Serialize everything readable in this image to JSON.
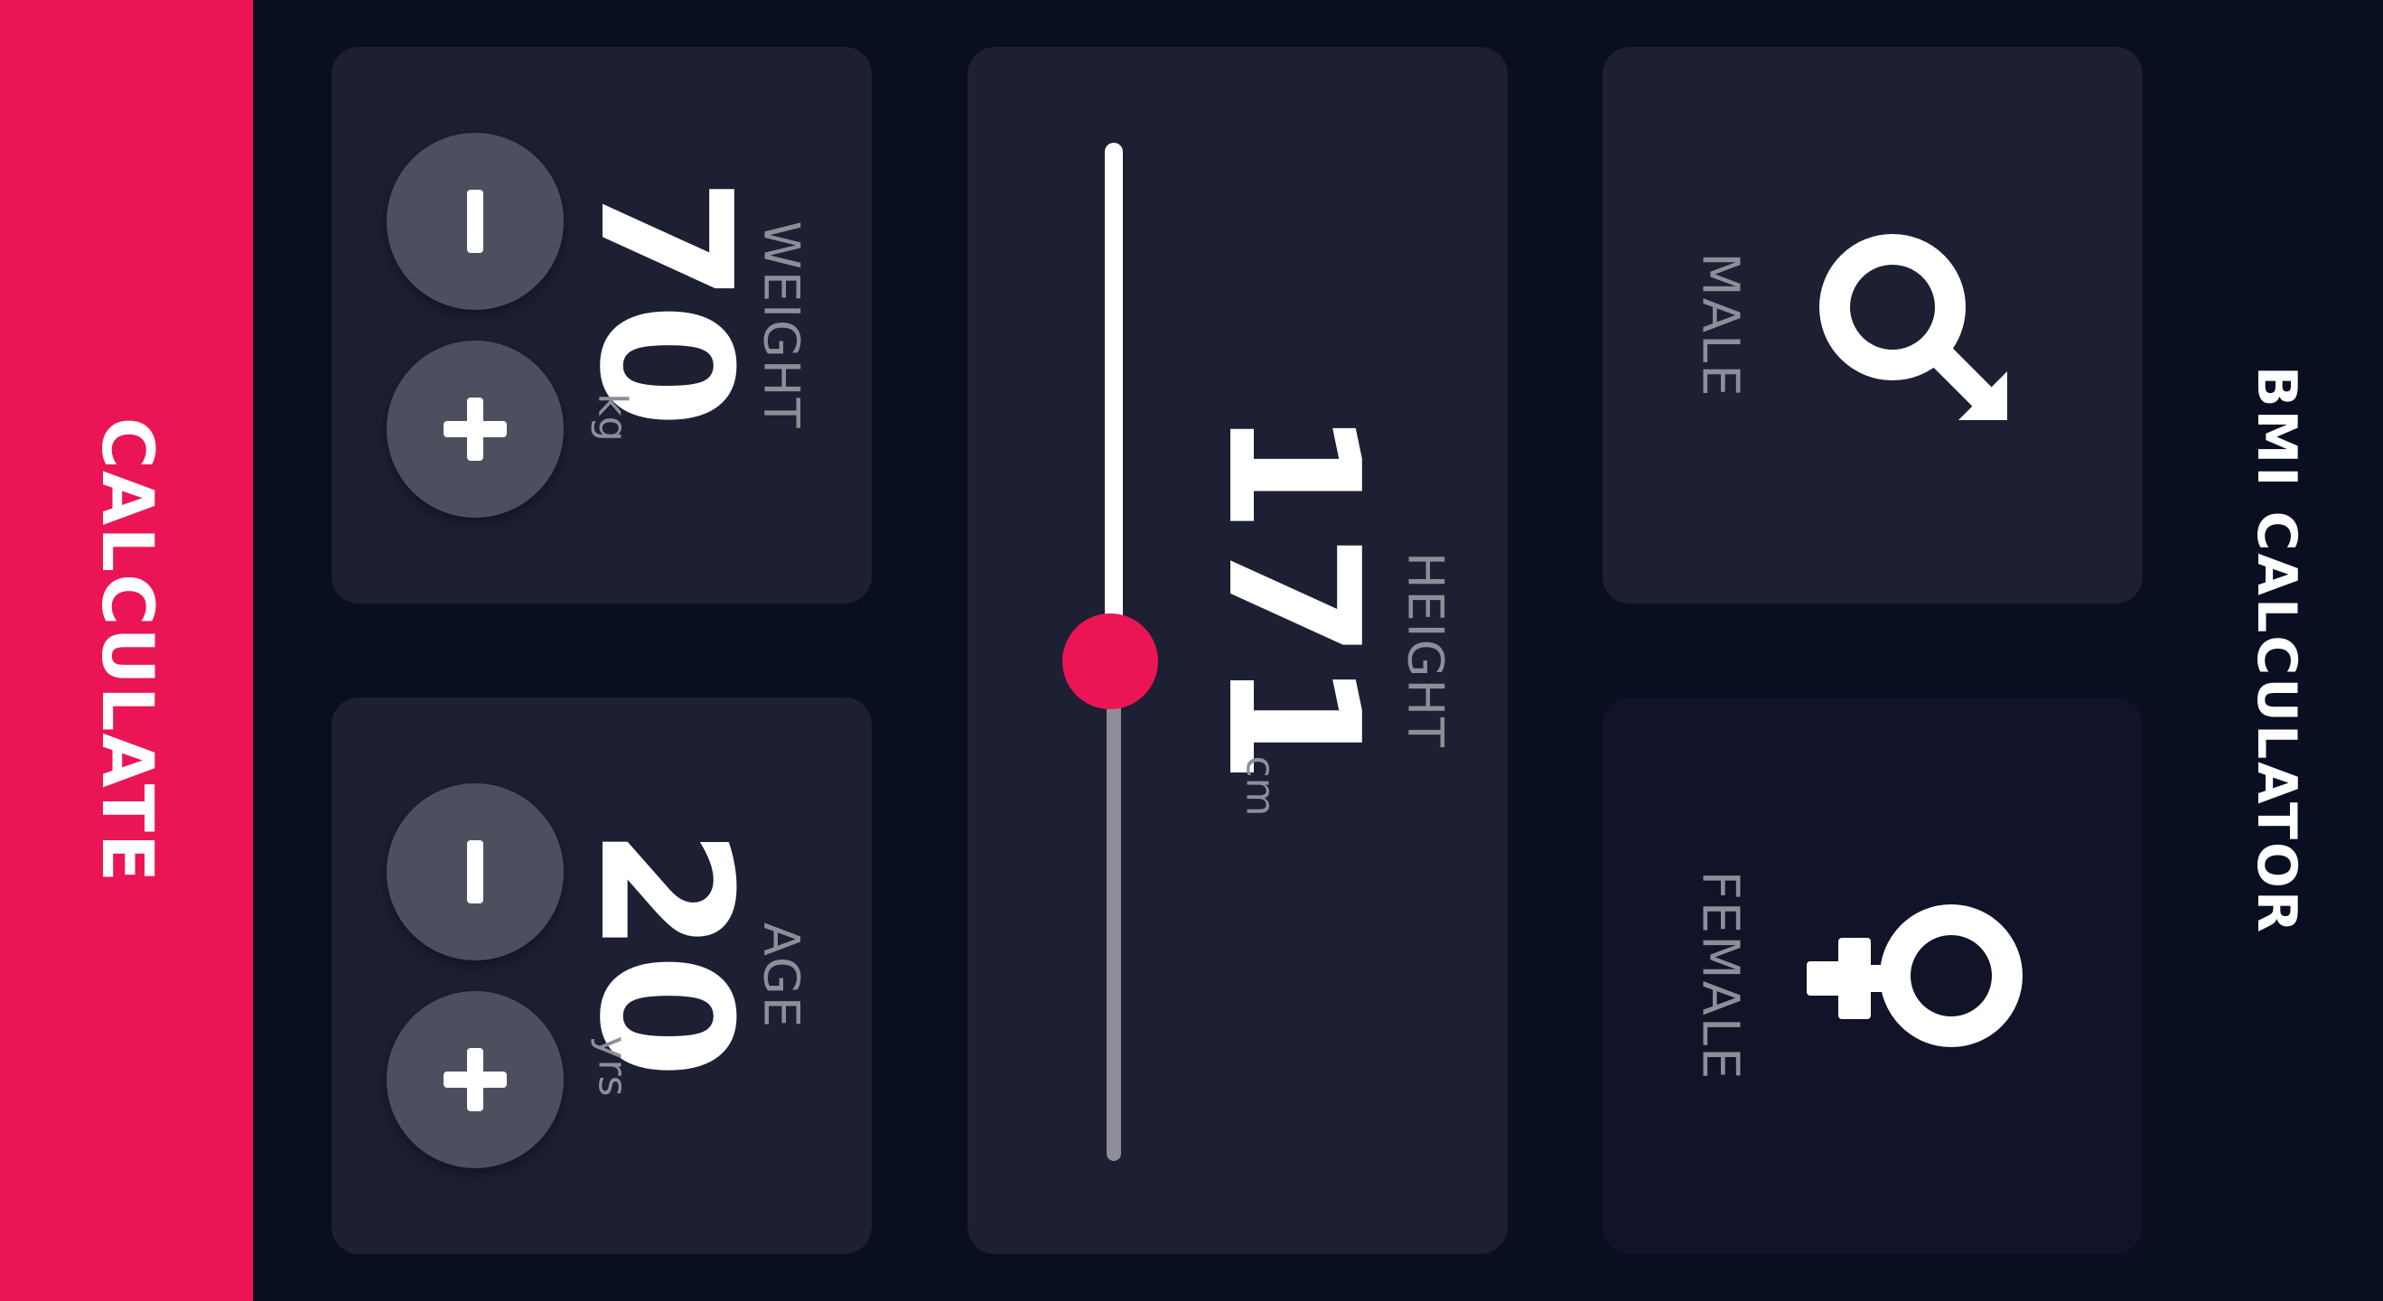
{
  "app": {
    "title": "BMI CALCULATOR"
  },
  "gender": {
    "male_label": "MALE",
    "female_label": "FEMALE",
    "male_icon": "male-symbol-icon",
    "female_icon": "female-symbol-icon"
  },
  "height": {
    "label": "HEIGHT",
    "value": "171",
    "unit": "cm"
  },
  "weight": {
    "label": "WEIGHT",
    "value": "70",
    "unit": "kg"
  },
  "age": {
    "label": "AGE",
    "value": "20",
    "unit": "yrs"
  },
  "actions": {
    "calculate_label": "CALCULATE"
  },
  "colors": {
    "background": "#0a0e21",
    "card": "#1d1f33",
    "card_inactive": "#111328",
    "accent": "#eb1555",
    "muted_text": "#8d8e98",
    "round_button": "#4c4f5e"
  }
}
